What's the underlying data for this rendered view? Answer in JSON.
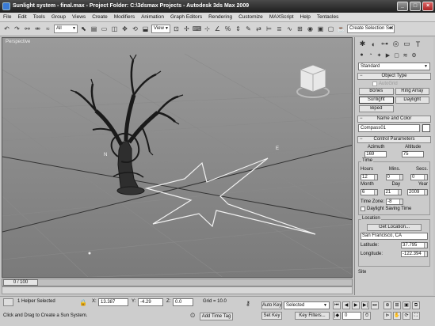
{
  "window": {
    "title": "Sunlight system - final.max    - Project Folder: C:\\3dsmax Projects    - Autodesk 3ds Max  2009"
  },
  "menu": [
    "File",
    "Edit",
    "Tools",
    "Group",
    "Views",
    "Create",
    "Modifiers",
    "Animation",
    "Graph Editors",
    "Rendering",
    "Customize",
    "MAXScript",
    "Help",
    "Tentacles"
  ],
  "toolbar": {
    "selection_filter": "All",
    "reference_coord": "View",
    "named_selection": "Create Selection Set"
  },
  "viewport": {
    "label": "Perspective",
    "compass_n": "N",
    "compass_e": "E"
  },
  "command_panel": {
    "category": "Standard",
    "object_type": {
      "title": "Object Type",
      "autogrid": "AutoGrid",
      "buttons": [
        "Bones",
        "Ring Array",
        "Sunlight",
        "Daylight",
        "Biped"
      ],
      "active": "Sunlight"
    },
    "name_color": {
      "title": "Name and Color",
      "name": "Compass01"
    },
    "control": {
      "title": "Control Parameters",
      "azimuth_label": "Azimuth",
      "azimuth": "169",
      "altitude_label": "Altitude",
      "altitude": "75",
      "time_label": "Time",
      "hours_label": "Hours",
      "hours": "12",
      "mins_label": "Mins.",
      "mins": "0",
      "secs_label": "Secs.",
      "secs": "0",
      "month_label": "Month",
      "month": "6",
      "day_label": "Day",
      "day": "21",
      "year_label": "Year",
      "year": "2009",
      "timezone_label": "Time Zone:",
      "timezone": "-8",
      "dst_label": "Daylight Saving Time",
      "location_label": "Location",
      "get_location": "Get Location...",
      "city": "San Francisco, CA",
      "latitude_label": "Latitude:",
      "latitude": "37.795",
      "longitude_label": "Longitude:",
      "longitude": "-122.394",
      "site_label": "Site"
    }
  },
  "timeline": {
    "frame": "0 / 100"
  },
  "status": {
    "selected": "1 Helper Selected",
    "prompt": "Click and Drag to Create a Sun System.",
    "x_label": "X:",
    "x": "13.387",
    "y_label": "Y:",
    "y": "-4.29",
    "z_label": "Z:",
    "z": "0.0",
    "grid": "Grid = 10.0",
    "add_time_tag": "Add Time Tag",
    "auto_key": "Auto Key",
    "set_key": "Set Key",
    "key_mode": "Selected",
    "key_filters": "Key Filters...",
    "frame_spinner": "0"
  }
}
